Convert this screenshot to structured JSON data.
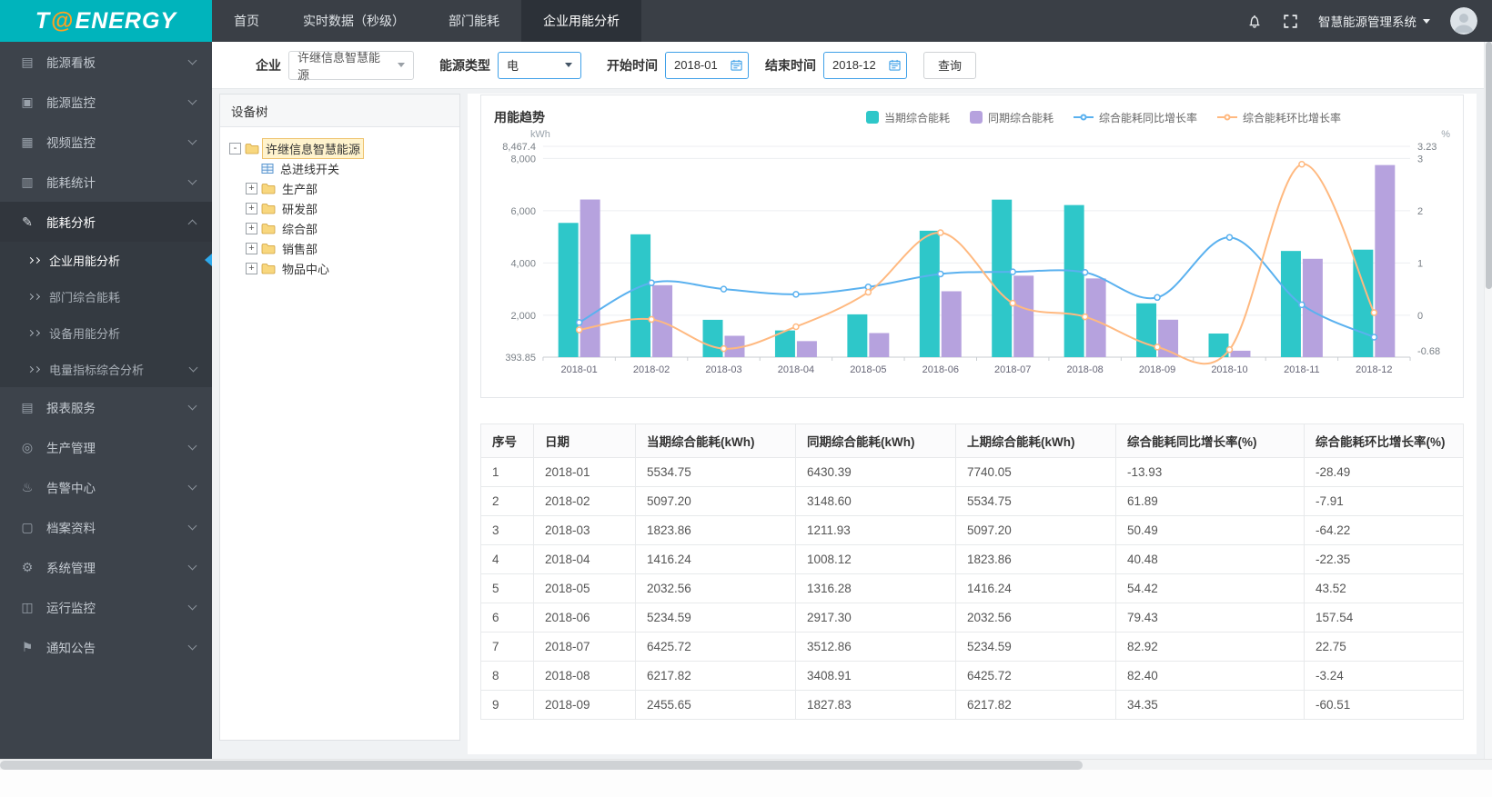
{
  "header": {
    "logo_t": "T",
    "logo_at": "@",
    "logo_rest": "ENERGY",
    "tabs": [
      {
        "label": "首页",
        "active": false
      },
      {
        "label": "实时数据（秒级）",
        "active": false
      },
      {
        "label": "部门能耗",
        "active": false
      },
      {
        "label": "企业用能分析",
        "active": true
      }
    ],
    "system_name": "智慧能源管理系统"
  },
  "sidebar": {
    "items": [
      {
        "label": "能源看板",
        "icon": "dashboard-icon",
        "glyph": "▤"
      },
      {
        "label": "能源监控",
        "icon": "monitor-icon",
        "glyph": "▣"
      },
      {
        "label": "视频监控",
        "icon": "video-icon",
        "glyph": "▦"
      },
      {
        "label": "能耗统计",
        "icon": "stats-icon",
        "glyph": "▥"
      },
      {
        "label": "能耗分析",
        "icon": "analysis-icon",
        "glyph": "✎",
        "active": true,
        "expanded": true,
        "children": [
          {
            "label": "企业用能分析",
            "active": true
          },
          {
            "label": "部门综合能耗",
            "active": false
          },
          {
            "label": "设备用能分析",
            "active": false
          },
          {
            "label": "电量指标综合分析",
            "active": false,
            "has_children": true
          }
        ]
      },
      {
        "label": "报表服务",
        "icon": "reports-icon",
        "glyph": "▤"
      },
      {
        "label": "生产管理",
        "icon": "production-icon",
        "glyph": "◎"
      },
      {
        "label": "告警中心",
        "icon": "alarm-icon",
        "glyph": "♨"
      },
      {
        "label": "档案资料",
        "icon": "archives-icon",
        "glyph": "▢"
      },
      {
        "label": "系统管理",
        "icon": "settings-icon",
        "glyph": "⚙"
      },
      {
        "label": "运行监控",
        "icon": "operation-icon",
        "glyph": "◫"
      },
      {
        "label": "通知公告",
        "icon": "notice-icon",
        "glyph": "⚑"
      }
    ]
  },
  "filters": {
    "enterprise_label": "企业",
    "enterprise_value": "许继信息智慧能源",
    "energy_type_label": "能源类型",
    "energy_type_value": "电",
    "start_label": "开始时间",
    "start_value": "2018-01",
    "end_label": "结束时间",
    "end_value": "2018-12",
    "query_button": "查询"
  },
  "tree": {
    "title": "设备树",
    "nodes": [
      {
        "label": "许继信息智慧能源",
        "icon": "folder",
        "toggle": "-",
        "level": 0,
        "selected": true
      },
      {
        "label": "总进线开关",
        "icon": "meter",
        "toggle": "",
        "level": 1,
        "selected": false
      },
      {
        "label": "生产部",
        "icon": "folder",
        "toggle": "+",
        "level": 1,
        "selected": false
      },
      {
        "label": "研发部",
        "icon": "folder",
        "toggle": "+",
        "level": 1,
        "selected": false
      },
      {
        "label": "综合部",
        "icon": "folder",
        "toggle": "+",
        "level": 1,
        "selected": false
      },
      {
        "label": "销售部",
        "icon": "folder",
        "toggle": "+",
        "level": 1,
        "selected": false
      },
      {
        "label": "物品中心",
        "icon": "folder",
        "toggle": "+",
        "level": 1,
        "selected": false
      }
    ]
  },
  "chart_data": {
    "type": "bar+line",
    "title": "用能趋势",
    "categories": [
      "2018-01",
      "2018-02",
      "2018-03",
      "2018-04",
      "2018-05",
      "2018-06",
      "2018-07",
      "2018-08",
      "2018-09",
      "2018-10",
      "2018-11",
      "2018-12"
    ],
    "series": [
      {
        "name": "当期综合能耗",
        "type": "bar",
        "axis": "left",
        "color": "#2ec7c9",
        "values": [
          5534.75,
          5097.2,
          1823.86,
          1416.24,
          2032.56,
          5234.59,
          6425.72,
          6217.82,
          2455.65,
          1298,
          4460,
          4510
        ]
      },
      {
        "name": "同期综合能耗",
        "type": "bar",
        "axis": "left",
        "color": "#b6a2de",
        "values": [
          6430.39,
          3148.6,
          1211.93,
          1008.12,
          1316.28,
          2917.3,
          3512.86,
          3408.91,
          1827.83,
          640,
          4160,
          7750
        ]
      },
      {
        "name": "综合能耗同比增长率",
        "type": "line",
        "axis": "right",
        "color": "#5ab1ef",
        "values": [
          -0.14,
          0.62,
          0.5,
          0.4,
          0.54,
          0.79,
          0.83,
          0.82,
          0.34,
          1.49,
          0.2,
          -0.42
        ]
      },
      {
        "name": "综合能耗环比增长率",
        "type": "line",
        "axis": "right",
        "color": "#ffb980",
        "values": [
          -0.28,
          -0.08,
          -0.64,
          -0.22,
          0.44,
          1.58,
          0.23,
          -0.03,
          -0.61,
          -0.66,
          2.89,
          0.05
        ]
      }
    ],
    "left_axis": {
      "name": "kWh",
      "min": 393.85,
      "max": 8467.4,
      "ticks": [
        393.85,
        2000,
        4000,
        6000,
        8000,
        8467.4
      ],
      "tick_labels": [
        "393.85",
        "2,000",
        "4,000",
        "6,000",
        "8,000",
        "8,467.4"
      ]
    },
    "right_axis": {
      "name": "%",
      "min": -0.68,
      "max": 3.23,
      "ticks": [
        -0.68,
        0,
        1,
        2,
        3,
        3.23
      ],
      "tick_labels": [
        "-0.68",
        "0",
        "1",
        "2",
        "3",
        "3.23"
      ],
      "zero_at_left": 2000,
      "per_unit_left": 2000
    },
    "legend_position": "top",
    "grid": true
  },
  "table": {
    "headers": [
      "序号",
      "日期",
      "当期综合能耗(kWh)",
      "同期综合能耗(kWh)",
      "上期综合能耗(kWh)",
      "综合能耗同比增长率(%)",
      "综合能耗环比增长率(%)"
    ],
    "rows": [
      [
        "1",
        "2018-01",
        "5534.75",
        "6430.39",
        "7740.05",
        "-13.93",
        "-28.49"
      ],
      [
        "2",
        "2018-02",
        "5097.20",
        "3148.60",
        "5534.75",
        "61.89",
        "-7.91"
      ],
      [
        "3",
        "2018-03",
        "1823.86",
        "1211.93",
        "5097.20",
        "50.49",
        "-64.22"
      ],
      [
        "4",
        "2018-04",
        "1416.24",
        "1008.12",
        "1823.86",
        "40.48",
        "-22.35"
      ],
      [
        "5",
        "2018-05",
        "2032.56",
        "1316.28",
        "1416.24",
        "54.42",
        "43.52"
      ],
      [
        "6",
        "2018-06",
        "5234.59",
        "2917.30",
        "2032.56",
        "79.43",
        "157.54"
      ],
      [
        "7",
        "2018-07",
        "6425.72",
        "3512.86",
        "5234.59",
        "82.92",
        "22.75"
      ],
      [
        "8",
        "2018-08",
        "6217.82",
        "3408.91",
        "6425.72",
        "82.40",
        "-3.24"
      ],
      [
        "9",
        "2018-09",
        "2455.65",
        "1827.83",
        "6217.82",
        "34.35",
        "-60.51"
      ]
    ]
  }
}
